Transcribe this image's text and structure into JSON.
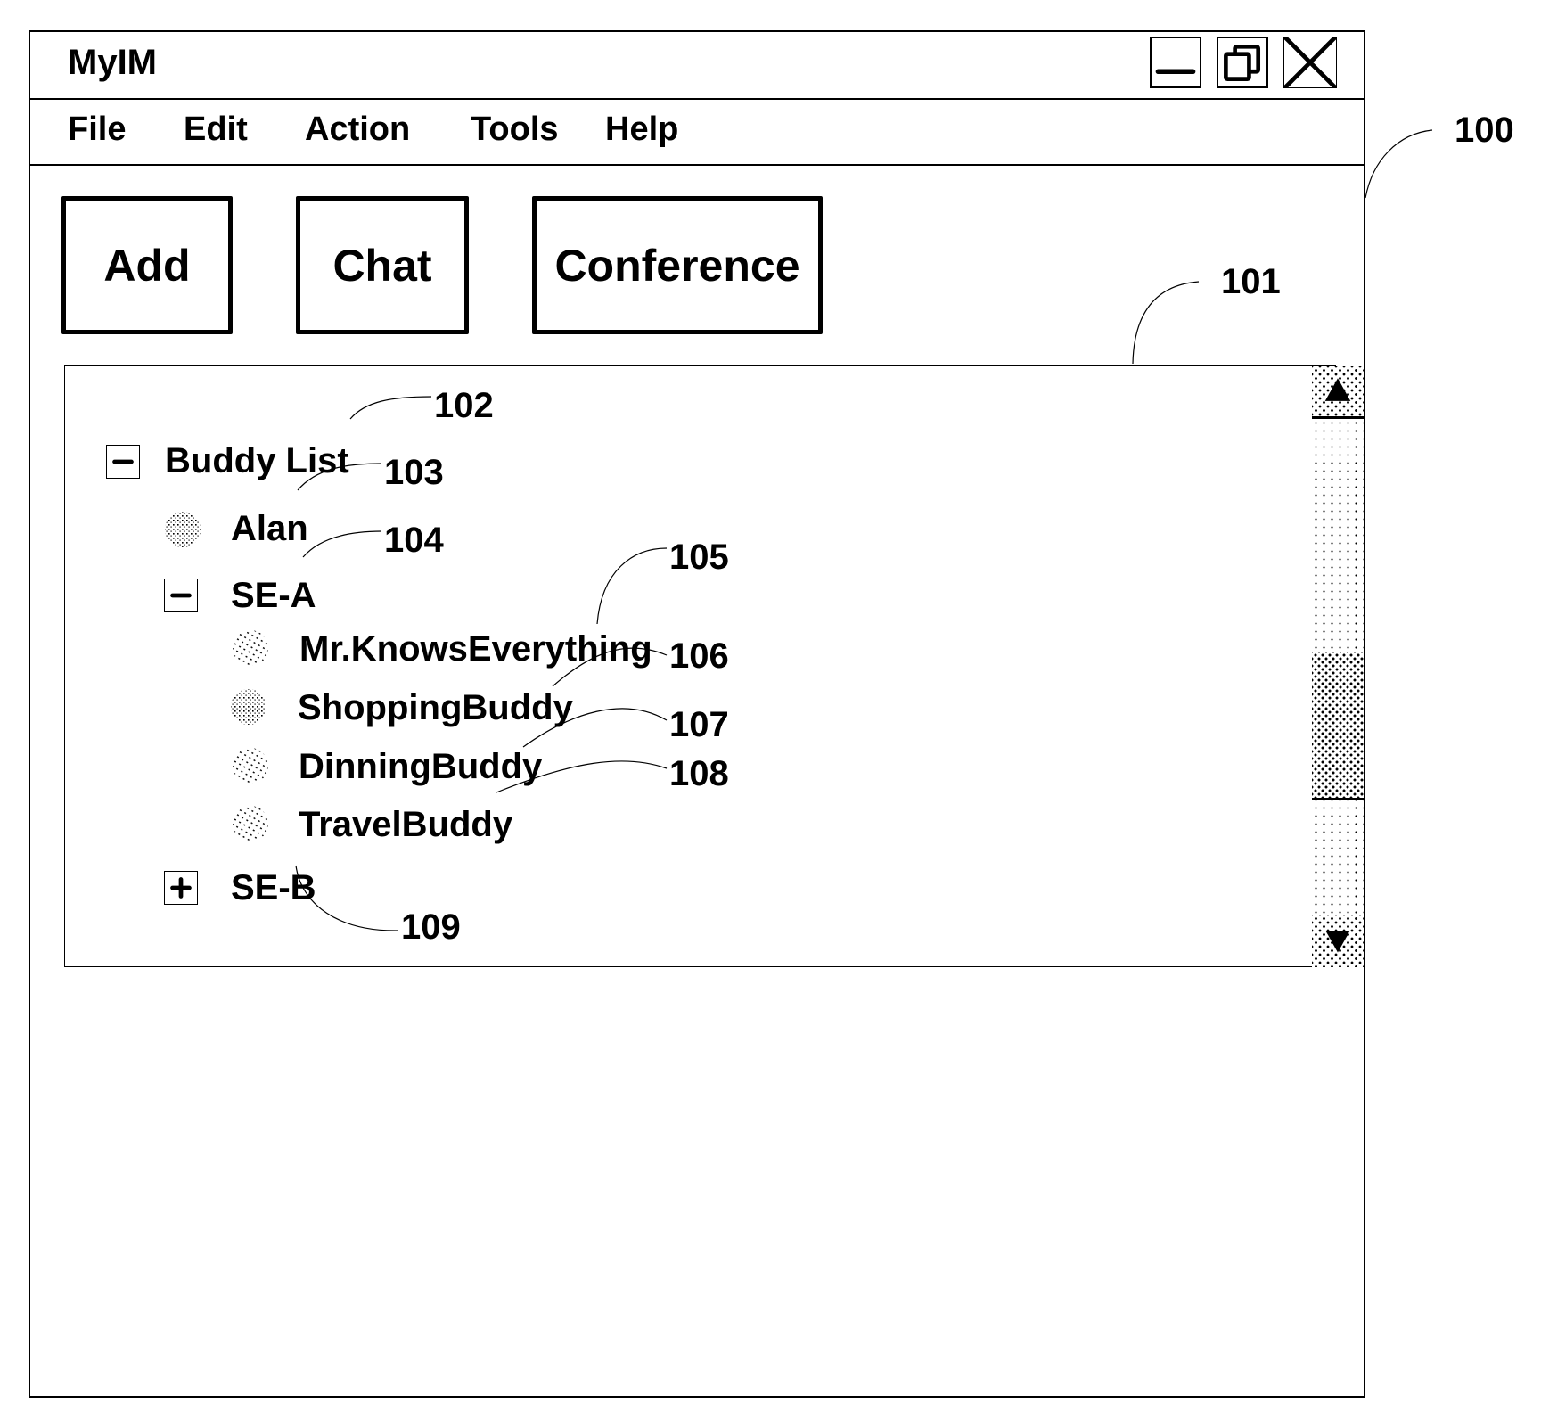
{
  "window": {
    "title": "MyIM",
    "controls": {
      "minimize_icon": "minimize-icon",
      "restore_icon": "restore-icon",
      "close_icon": "close-icon"
    }
  },
  "menubar": {
    "items": [
      {
        "label": "File"
      },
      {
        "label": "Edit"
      },
      {
        "label": "Action"
      },
      {
        "label": "Tools"
      },
      {
        "label": "Help"
      }
    ]
  },
  "toolbar": {
    "buttons": [
      {
        "label": "Add"
      },
      {
        "label": "Chat"
      },
      {
        "label": "Conference"
      }
    ]
  },
  "buddy_list": {
    "root": {
      "label": "Buddy List",
      "expanded": true,
      "toggle_symbol": "minus"
    },
    "contacts": [
      {
        "label": "Alan",
        "icon": "buddy-status-icon"
      }
    ],
    "groups": [
      {
        "label": "SE-A",
        "expanded": true,
        "toggle_symbol": "minus",
        "members": [
          {
            "label": "Mr.KnowsEverything",
            "icon": "buddy-status-icon"
          },
          {
            "label": "ShoppingBuddy",
            "icon": "buddy-status-icon"
          },
          {
            "label": "DinningBuddy",
            "icon": "buddy-status-icon"
          },
          {
            "label": "TravelBuddy",
            "icon": "buddy-status-icon"
          }
        ]
      },
      {
        "label": "SE-B",
        "expanded": false,
        "toggle_symbol": "plus",
        "members": []
      }
    ]
  },
  "scrollbar": {
    "thumb_start_fraction": 0.47,
    "thumb_end_fraction": 0.77
  },
  "reference_numerals": {
    "window": "100",
    "buddy_panel": "101",
    "buddy_list_root": "102",
    "alan": "103",
    "group_se_a": "104",
    "mr_knows_everything": "105",
    "shopping_buddy": "106",
    "dinning_buddy": "107",
    "travel_buddy": "108",
    "group_se_b": "109"
  }
}
